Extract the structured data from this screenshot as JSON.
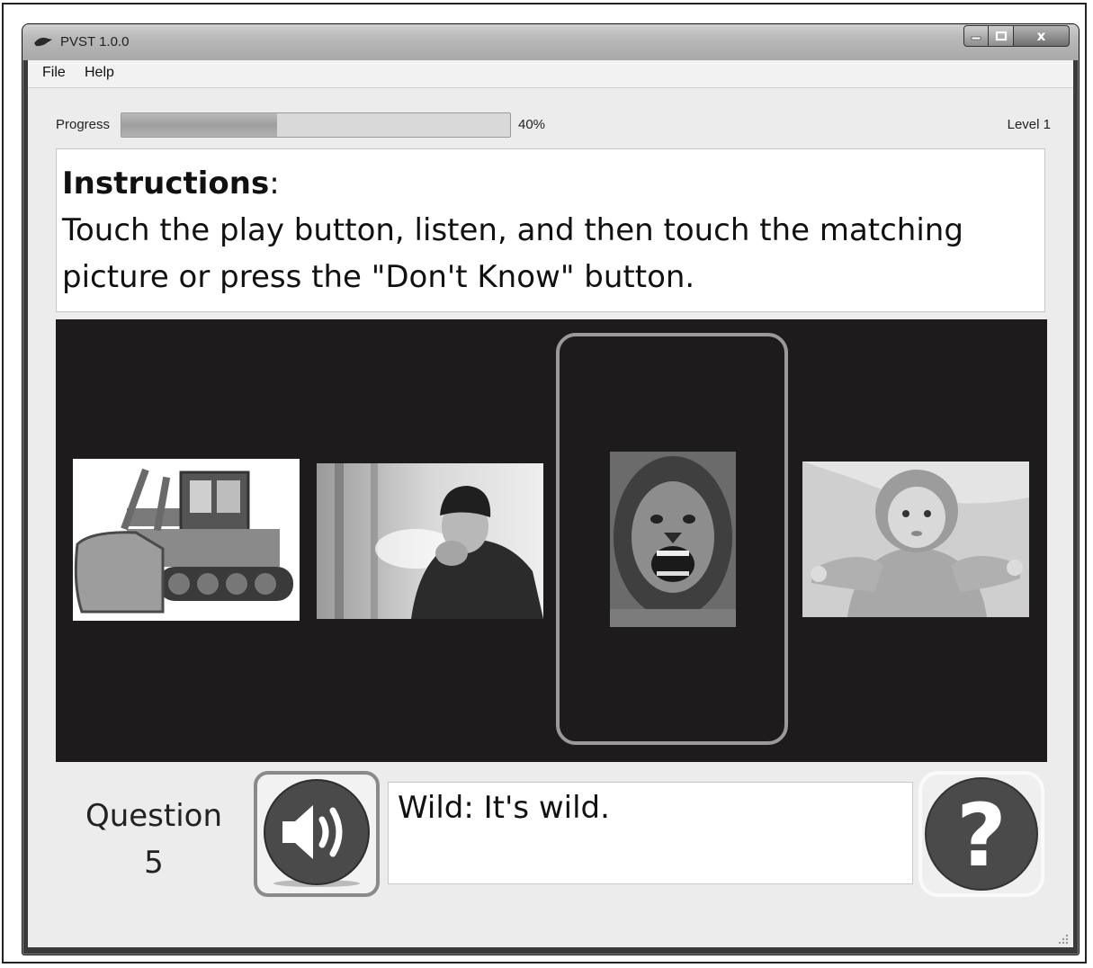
{
  "window": {
    "title": "PVST 1.0.0",
    "controls": {
      "minimize_icon": "minimize-icon",
      "maximize_icon": "maximize-icon",
      "close_label": "x"
    }
  },
  "menu": {
    "items": [
      {
        "label": "File"
      },
      {
        "label": "Help"
      }
    ]
  },
  "progress": {
    "label": "Progress",
    "value": 0.4,
    "percent_text": "40%"
  },
  "level": {
    "text": "Level 1"
  },
  "instructions": {
    "heading": "Instructions",
    "heading_suffix": ":",
    "body": "Touch the play button, listen, and then touch the matching picture or press the \"Don't Know\" button."
  },
  "pictures": [
    {
      "subject": "bulldozer",
      "selected": false
    },
    {
      "subject": "man-blowing-on-hands-in-cold",
      "selected": false
    },
    {
      "subject": "roaring-lion",
      "selected": true
    },
    {
      "subject": "baby-in-hooded-jacket",
      "selected": false
    }
  ],
  "question": {
    "label": "Question",
    "number": "5"
  },
  "play_button": {
    "icon": "speaker-icon"
  },
  "answer_text": "Wild: It's wild.",
  "dont_know_button": {
    "icon": "question-mark-icon",
    "glyph": "?"
  },
  "colors": {
    "panel_bg": "#1e1b1c",
    "selected_border": "#9a9a9a",
    "client_bg": "#ececec"
  }
}
